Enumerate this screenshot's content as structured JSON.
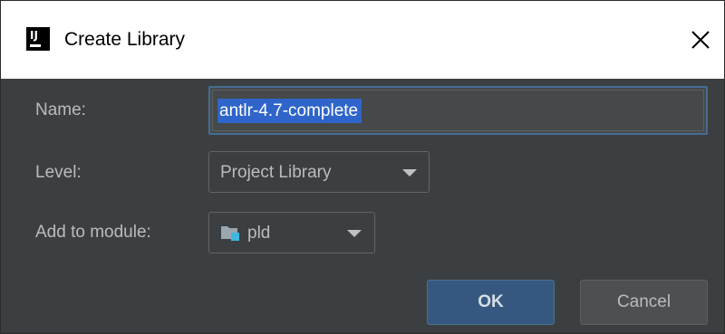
{
  "window": {
    "title": "Create Library",
    "app_icon_text": "IJ"
  },
  "form": {
    "name": {
      "label": "Name:",
      "value": "antlr-4.7-complete"
    },
    "level": {
      "label": "Level:",
      "selected": "Project Library"
    },
    "module": {
      "label": "Add to module:",
      "selected": "pld"
    }
  },
  "buttons": {
    "ok": "OK",
    "cancel": "Cancel"
  },
  "colors": {
    "background": "#3c3f41",
    "selection": "#2f65ca",
    "focus_border": "#466d94",
    "ok_button": "#365880",
    "cancel_button": "#4c5052"
  }
}
